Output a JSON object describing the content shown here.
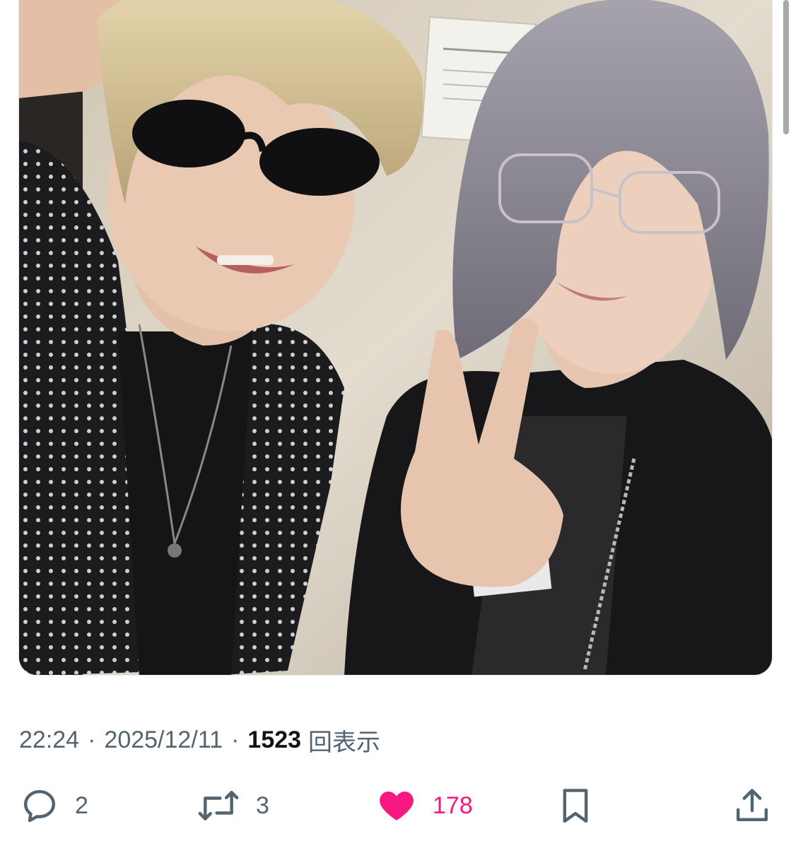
{
  "photo": {
    "alt_icon": "photo-image",
    "colors": {
      "wall": "#dcd3c4",
      "jacket": "#1b1b1d",
      "hair_left": "#d8c59a",
      "hair_right": "#8f8c96",
      "skin": "#e8c8b2"
    }
  },
  "tweet_meta": {
    "time": "22:24",
    "separator": "·",
    "date": "2025/12/11",
    "views_count": "1523",
    "views_label": "回表示"
  },
  "actions": {
    "reply": {
      "icon": "reply-icon",
      "count": "2"
    },
    "retweet": {
      "icon": "retweet-icon",
      "count": "3"
    },
    "like": {
      "icon": "heart-icon",
      "count": "178",
      "color": "#f91880"
    },
    "bookmark": {
      "icon": "bookmark-icon"
    },
    "share": {
      "icon": "share-icon"
    }
  },
  "colors": {
    "muted_text": "#536471",
    "primary_text": "#0f1419",
    "like_pink": "#f91880"
  }
}
